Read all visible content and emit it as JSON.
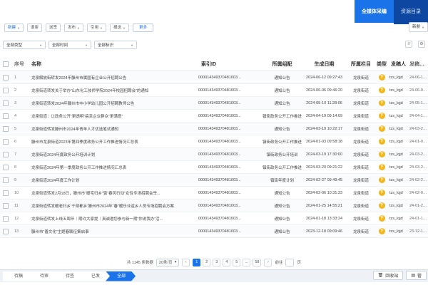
{
  "topbar": {
    "tabs": [
      {
        "label": "全媒体采编"
      },
      {
        "label": "资源目录"
      }
    ]
  },
  "toolbar": {
    "new": "新建",
    "sendback": "退审",
    "approve": "送签",
    "publish": "发布",
    "cite": "引用",
    "report": "报送",
    "more": "更多",
    "right_tool": "新朋"
  },
  "filters": {
    "type": "全部类型",
    "time": "全部时间",
    "mark": "全部标识"
  },
  "table": {
    "headers": {
      "no": "序号",
      "name": "名称",
      "index_id": "索引ID",
      "col": "所属组配",
      "gen_date": "生成日期",
      "col2": "所属栏目",
      "type": "类型",
      "user": "发稿人",
      "time": "发稿时间"
    },
    "rows": [
      {
        "no": "1",
        "name": "龙泉解放街转发2024年滕州市属国有企业公开招聘公告",
        "id": "000014349370481003...",
        "col": "通知公告",
        "date": "2024-06-12 09:27:43",
        "col2": "龙泉街道",
        "type": "下",
        "user": "tzs_lqjd",
        "time": "24-06-17 09:37"
      },
      {
        "no": "2",
        "name": "龙泉街道转发关于举办“山东化工技师学院2024年校园招聘会”的通知",
        "id": "000014349370481003...",
        "col": "通知公告",
        "date": "2024-06-06 09:46:20",
        "col2": "龙泉街道",
        "type": "下",
        "user": "tzs_lqjd",
        "time": "24-06-06 09:46"
      },
      {
        "no": "3",
        "name": "龙泉街道转发2024年滕州市中小学幼儿园公开招聘教师公告",
        "id": "000014349370481003...",
        "col": "通知公告",
        "date": "2024-05-10 11:28:06",
        "col2": "龙泉街道",
        "type": "下",
        "user": "tzs_lqjd",
        "time": "24-05-10 11:28"
      },
      {
        "no": "4",
        "name": "龙泉街道：让政务公开“更透明”搞幸企业群众“更满意”",
        "id": "000014349370481003...",
        "col": "镇街政务公开工作推进",
        "date": "2024-04-19 09:14:09",
        "col2": "龙泉街道",
        "type": "下",
        "user": "tzs_lqjd",
        "time": "24-04-19 09:14"
      },
      {
        "no": "5",
        "name": "龙泉街道转发滕州市2024年青年人才优选笔试通知",
        "id": "000014349370481003...",
        "col": "通知公告",
        "date": "2024-03-19 10:22:17",
        "col2": "龙泉街道",
        "type": "下",
        "user": "tzs_lqjd",
        "time": "24-03-21 10:22"
      },
      {
        "no": "6",
        "name": "滕州市龙泉街道2023年第四季度政务公开工作推进情况汇总表",
        "id": "000014349370481003...",
        "col": "镇街政务公开工作推进",
        "date": "2024-01-03 09:58:18",
        "col2": "龙泉街道",
        "type": "下",
        "user": "tzs_lqjd",
        "time": "24-01-03 09:58"
      },
      {
        "no": "7",
        "name": "龙泉街道2024年度政务公开培训计划",
        "id": "000014349370481003...",
        "col": "镇街政务公开培训",
        "date": "2024-03-19 17:30:00",
        "col2": "龙泉街道",
        "type": "下",
        "user": "tzs_lqjd",
        "time": "24-03-20 10:58"
      },
      {
        "no": "8",
        "name": "龙泉街道2024年第一季度政务公开工作推进情况汇总表",
        "id": "000014349370481003...",
        "col": "镇街政务公开工作推进",
        "date": "2024-03-20 09:21:22",
        "col2": "龙泉街道",
        "type": "下",
        "user": "tzs_lqjd",
        "time": "24-03-20 09:21"
      },
      {
        "no": "9",
        "name": "龙泉街道2024年度工作计划",
        "id": "000014349370481003...",
        "col": "镇街年度计划",
        "date": "2024-02-27 09:49:45",
        "col2": "龙泉街道",
        "type": "下",
        "user": "tzs_lqjd",
        "time": "24-02-27 09:50"
      },
      {
        "no": "10",
        "name": "龙泉街道转发2月18日，滕州市“暖宅归乡”暨“春风行动”女性专场招聘会举...",
        "id": "000014349370481003...",
        "col": "通知公告",
        "date": "2024-02-06 10:31:33",
        "col2": "龙泉街道",
        "type": "下",
        "user": "tzs_lqjd",
        "time": "24-02-06 10:31"
      },
      {
        "no": "11",
        "name": "龙泉街道转发暖老归乡‘干部都乡’滕州市2024年“春”暖乐业返乡人员专场招聘会方案",
        "id": "000014349370481003...",
        "col": "通知公告",
        "date": "2024-01-25 14:55:21",
        "col2": "龙泉街道",
        "type": "下",
        "user": "tzs_lqjd",
        "time": "24-01-25 14:55"
      },
      {
        "no": "12",
        "name": "龙泉街道转发上线五周年｜期许大家提｜真诚邀您参与新一期“你说我办”活...",
        "id": "000014349370481003...",
        "col": "通知公告",
        "date": "2024-01-18 13:33:24",
        "col2": "龙泉街道",
        "type": "下",
        "user": "tzs_lqjd",
        "time": "24-01-18 13:33"
      },
      {
        "no": "13",
        "name": "滕州市“善文化”主题春联征集启事",
        "id": "000014349370481003...",
        "col": "通知公告",
        "date": "2023-12-18 09:09:46",
        "col2": "龙泉街道",
        "type": "下",
        "user": "tzs_lqjd",
        "time": "23-12-18 09:09"
      }
    ]
  },
  "pager": {
    "total": "共 1145 条数据",
    "page_size": "20条/页",
    "pages": [
      "1",
      "2",
      "3",
      "4",
      "5",
      "...",
      "58"
    ],
    "active_page": "1",
    "goto_label": "前往",
    "page_unit": "页"
  },
  "bottombar": {
    "steps": [
      "待稿",
      "待审",
      "待签",
      "已发",
      "全部"
    ],
    "active_step": "全部",
    "recycle": "回收站",
    "right_label": "管"
  }
}
